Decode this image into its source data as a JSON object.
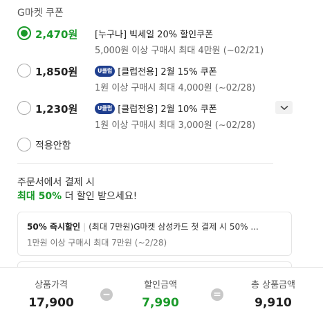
{
  "section_title": "G마켓 쿠폰",
  "coupons": [
    {
      "price": "2,470원",
      "selected": true,
      "badge": "",
      "title": "[누구나] 빅세일 20% 할인쿠폰",
      "desc": "5,000원 이상 구매시 최대 4만원 (~02/21)"
    },
    {
      "price": "1,850원",
      "selected": false,
      "badge": "U클럽",
      "title": "[클럽전용] 2월 15% 쿠폰",
      "desc": "1원 이상 구매시 최대 4,000원 (~02/28)"
    },
    {
      "price": "1,230원",
      "selected": false,
      "badge": "U클럽",
      "title": "[클럽전용] 2월 10% 쿠폰",
      "desc": "1원 이상 구매시 최대 3,000원 (~02/28)"
    }
  ],
  "no_apply_label": "적용안함",
  "promo": {
    "line1": "주문서에서 결제 시",
    "highlight": "최대 50%",
    "line2_rest": " 더 할인 받으세요!"
  },
  "card_offer": {
    "bold": "50% 즉시할인",
    "text": "(최대 7만원)G마켓 삼성카드 첫 결제 시 50% ...",
    "desc": "1만원 이상 구매시 최대 7만원 (~2/28)"
  },
  "summary": {
    "product_price_label": "상품가격",
    "product_price": "17,900",
    "discount_label": "할인금액",
    "discount": "7,990",
    "total_label": "총 상품금액",
    "total": "9,910",
    "minus": "−",
    "equals": "="
  },
  "colors": {
    "accent": "#1a9a2a",
    "badge": "#1f3f8f"
  },
  "icons": {
    "expand": "chevron-down-icon"
  }
}
